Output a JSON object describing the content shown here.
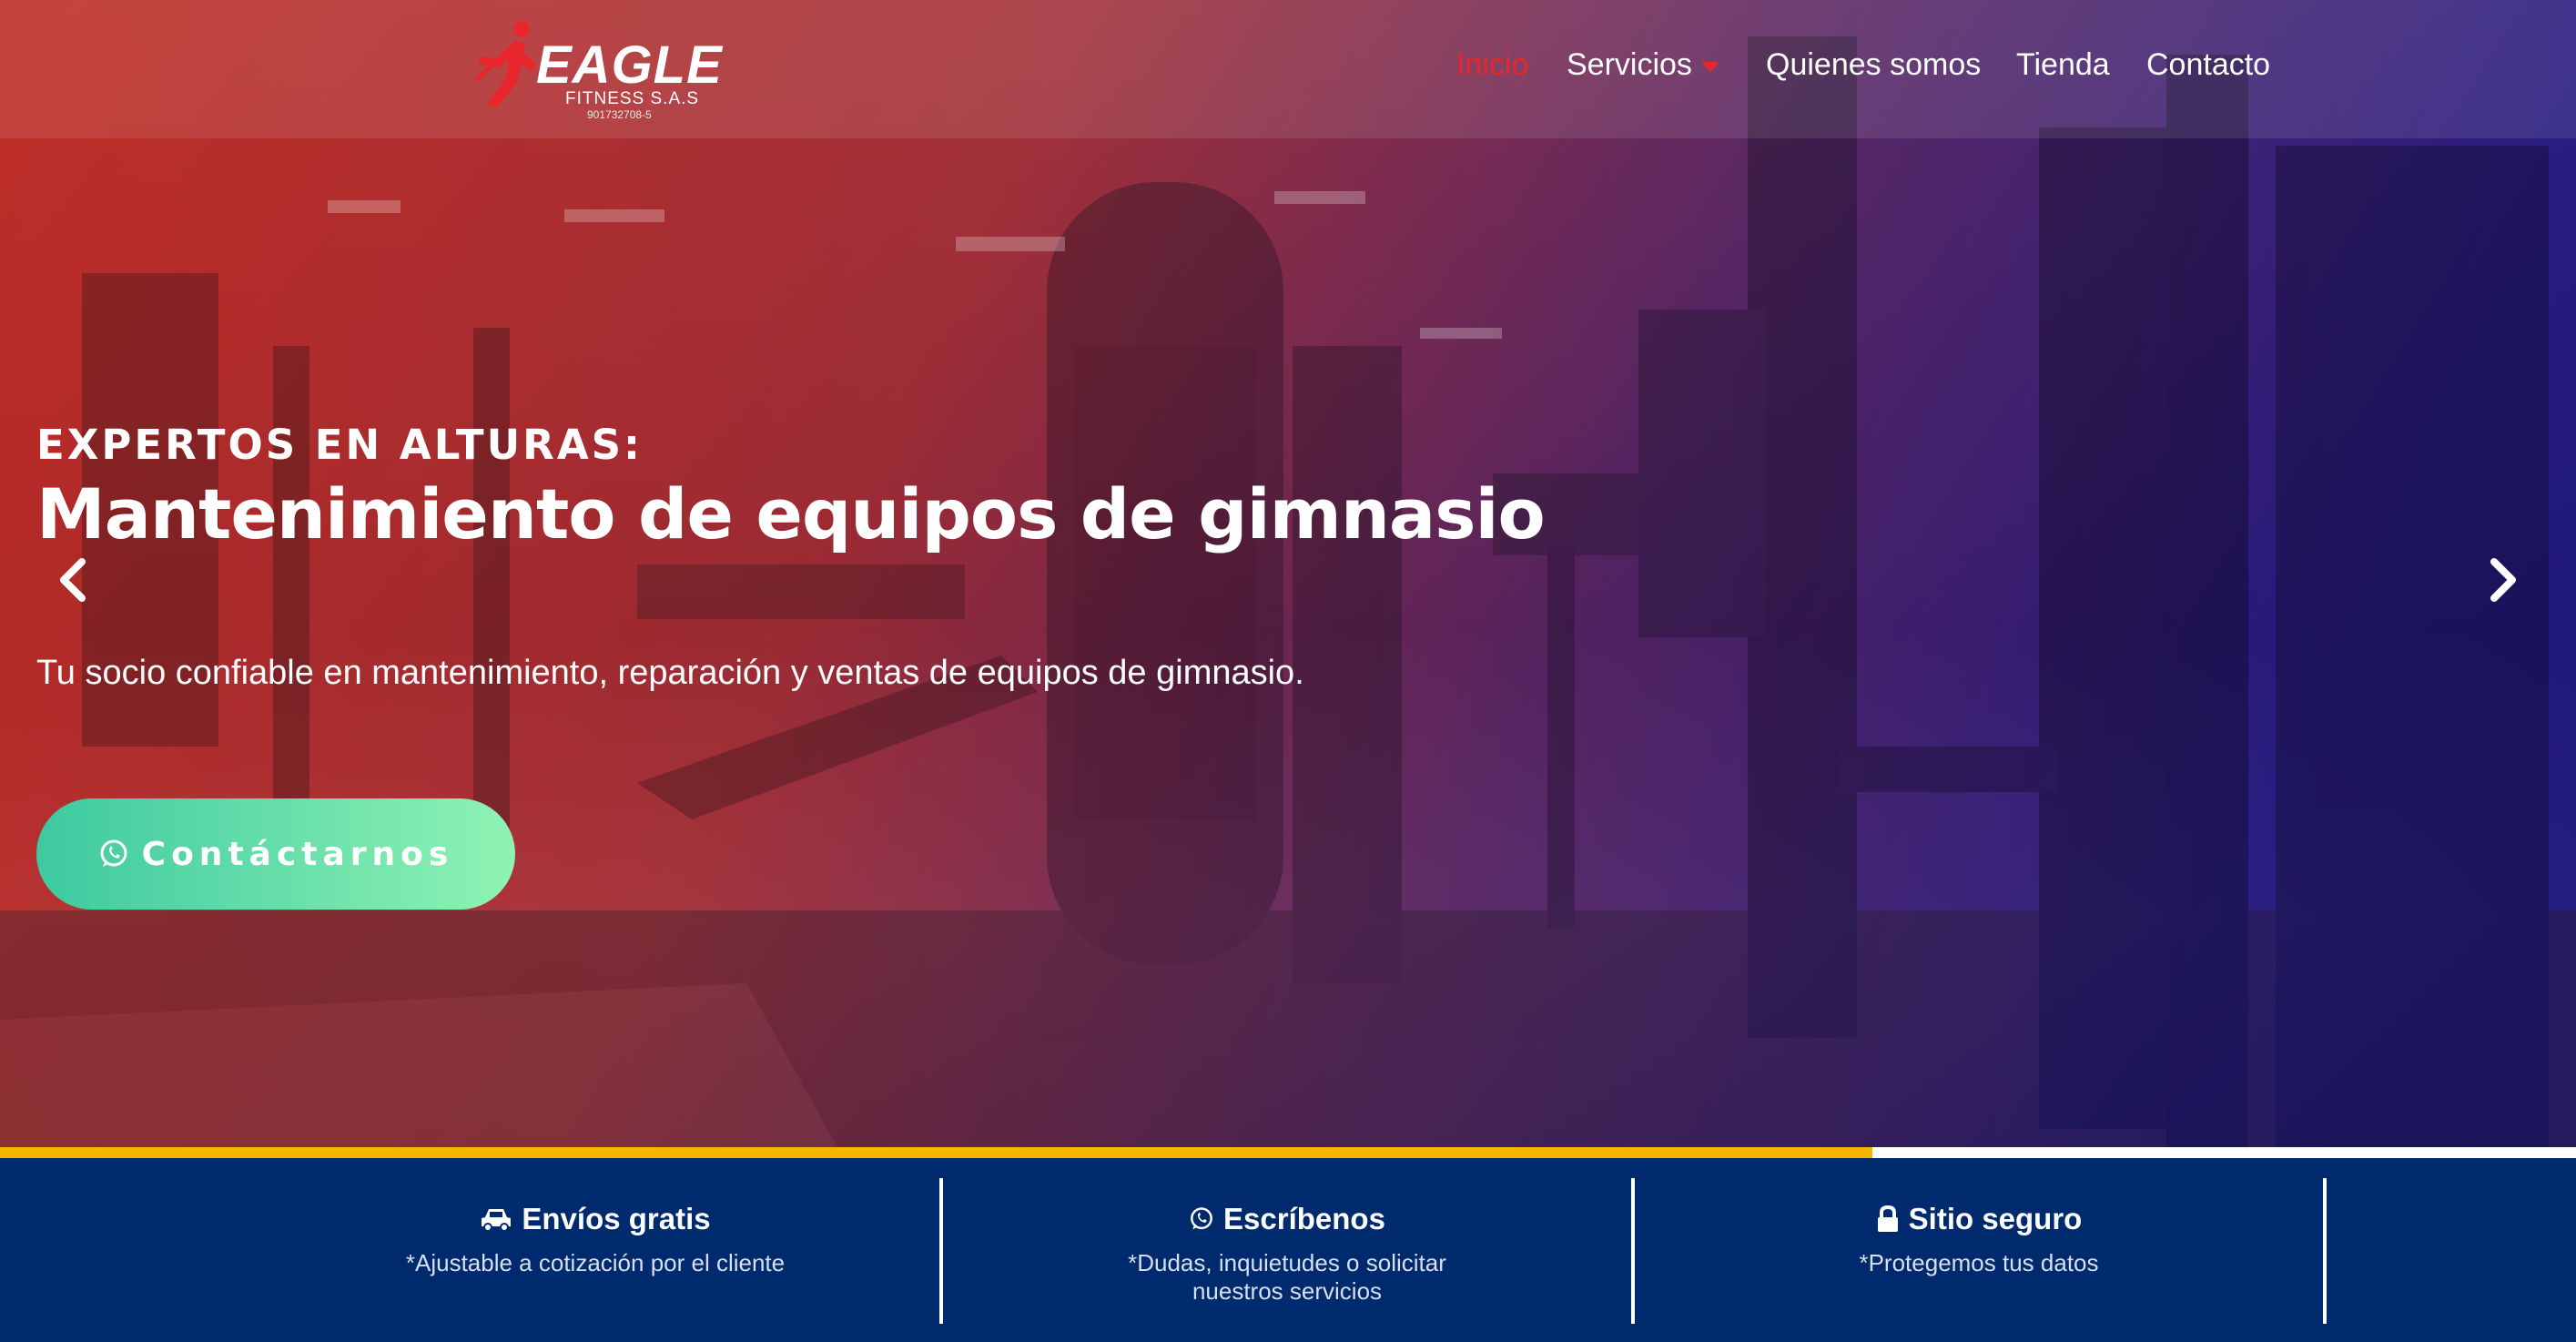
{
  "header": {
    "brand": "EAGLE",
    "brand_sub": "FITNESS S.A.S",
    "brand_nit": "901732708-5",
    "nav": [
      {
        "label": "Inicio",
        "active": true
      },
      {
        "label": "Servicios",
        "active": false,
        "has_dropdown": true
      },
      {
        "label": "Quienes somos",
        "active": false
      },
      {
        "label": "Tienda",
        "active": false
      },
      {
        "label": "Contacto",
        "active": false
      }
    ]
  },
  "hero": {
    "eyebrow": "EXPERTOS EN ALTURAS:",
    "headline": "Mantenimiento de equipos de gimnasio",
    "subtext": "Tu socio confiable en mantenimiento, reparación y ventas de equipos de gimnasio.",
    "cta_label": "Contáctarnos",
    "cta_icon": "whatsapp-icon",
    "prev_icon": "chevron-left-icon",
    "next_icon": "chevron-right-icon",
    "slide_progress": 0.727
  },
  "features": [
    {
      "icon": "car-icon",
      "title": "Envíos gratis",
      "desc": "*Ajustable a cotización por el cliente"
    },
    {
      "icon": "whatsapp-icon",
      "title": "Escríbenos",
      "desc": "*Dudas, inquietudes o solicitar nuestros servicios"
    },
    {
      "icon": "lock-icon",
      "title": "Sitio seguro",
      "desc": "*Protegemos tus datos"
    }
  ],
  "colors": {
    "accent_red": "#e8262b",
    "cta_start": "#3dc9a0",
    "cta_end": "#8ff3b4",
    "progress_yellow": "#f5b700",
    "footer_bg": "#002a6e"
  }
}
